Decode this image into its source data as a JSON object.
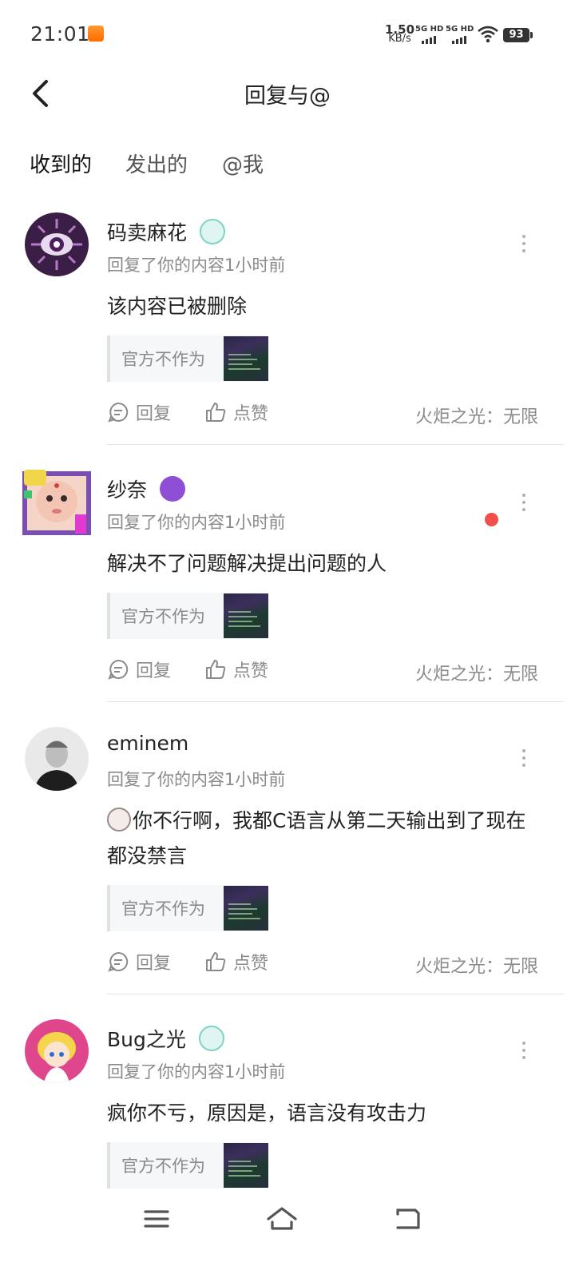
{
  "status_bar": {
    "time": "21:01",
    "net_speed_value": "1.50",
    "net_speed_unit": "KB/s",
    "sim1_label": "5G HD",
    "sim2_label": "5G HD",
    "battery": "93"
  },
  "header": {
    "title": "回复与@"
  },
  "tabs": [
    {
      "label": "收到的",
      "active": true
    },
    {
      "label": "发出的",
      "active": false
    },
    {
      "label": "@我",
      "active": false
    }
  ],
  "items": [
    {
      "username": "码卖麻花",
      "badge": "teal-lamp-badge",
      "meta": "回复了你的内容1小时前",
      "content": "该内容已被删除",
      "quote": "官方不作为",
      "reply_label": "回复",
      "like_label": "点赞",
      "fire_label": "火炬之光：无限",
      "unread": false
    },
    {
      "username": "纱奈",
      "badge": "purple-gamepad-badge",
      "meta": "回复了你的内容1小时前",
      "content": "解决不了问题解决提出问题的人",
      "quote": "官方不作为",
      "reply_label": "回复",
      "like_label": "点赞",
      "fire_label": "火炬之光：无限",
      "unread": true
    },
    {
      "username": "eminem",
      "badge": "",
      "meta": "回复了你的内容1小时前",
      "content": "你不行啊，我都C语言从第二天输出到了现在都没禁言",
      "quote": "官方不作为",
      "reply_label": "回复",
      "like_label": "点赞",
      "fire_label": "火炬之光：无限",
      "unread": false
    },
    {
      "username": "Bug之光",
      "badge": "teal-lamp-badge",
      "meta": "回复了你的内容1小时前",
      "content": "疯你不亏，原因是，语言没有攻击力",
      "quote": "官方不作为",
      "unread": false
    }
  ],
  "colors": {
    "tab_underline": "#2fd4c4",
    "unread_dot": "#f0504a",
    "meta_gray": "#8a8a8a"
  }
}
